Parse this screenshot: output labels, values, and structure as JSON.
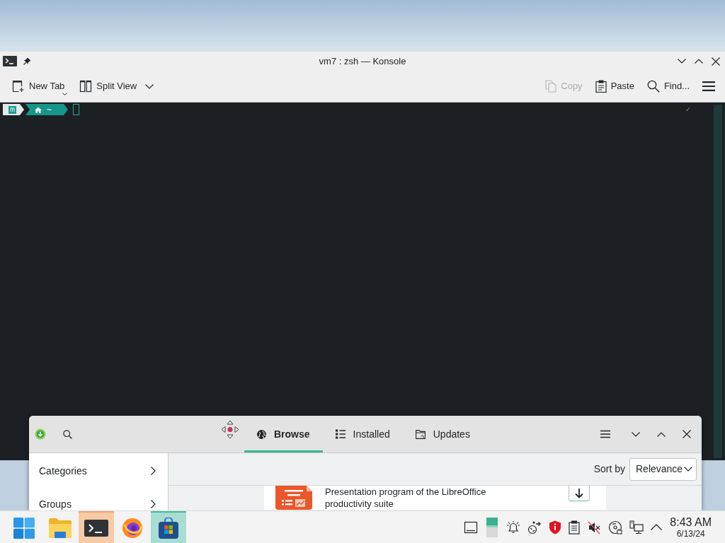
{
  "konsole": {
    "title": "vm7 : zsh — Konsole",
    "toolbar_left": [
      {
        "label": "New Tab",
        "corner_menu": true,
        "dropdown": false,
        "disabled": false
      },
      {
        "label": "Split View",
        "corner_menu": false,
        "dropdown": true,
        "disabled": false
      }
    ],
    "toolbar_right": [
      {
        "label": "Copy",
        "disabled": true
      },
      {
        "label": "Paste",
        "disabled": false
      },
      {
        "label": "Find...",
        "disabled": false
      }
    ],
    "terminal": {
      "prompt_path": "~",
      "status": "✓"
    }
  },
  "discover": {
    "tabs": [
      {
        "label": "Browse",
        "selected": true
      },
      {
        "label": "Installed",
        "selected": false
      },
      {
        "label": "Updates",
        "selected": false
      }
    ],
    "sidebar": [
      {
        "label": "Categories"
      },
      {
        "label": "Groups"
      }
    ],
    "sort": {
      "label": "Sort by",
      "value": "Relevance"
    },
    "apps": [
      {
        "description": "Presentation program of the LibreOffice productivity suite"
      }
    ]
  },
  "taskbar": {
    "apps": [
      {
        "active": false,
        "attention": false
      },
      {
        "active": false,
        "attention": false
      },
      {
        "active": false,
        "attention": true
      },
      {
        "active": false,
        "attention": false
      },
      {
        "active": true,
        "attention": false
      }
    ],
    "clock": {
      "time": "8:43 AM",
      "date": "6/13/24"
    }
  }
}
